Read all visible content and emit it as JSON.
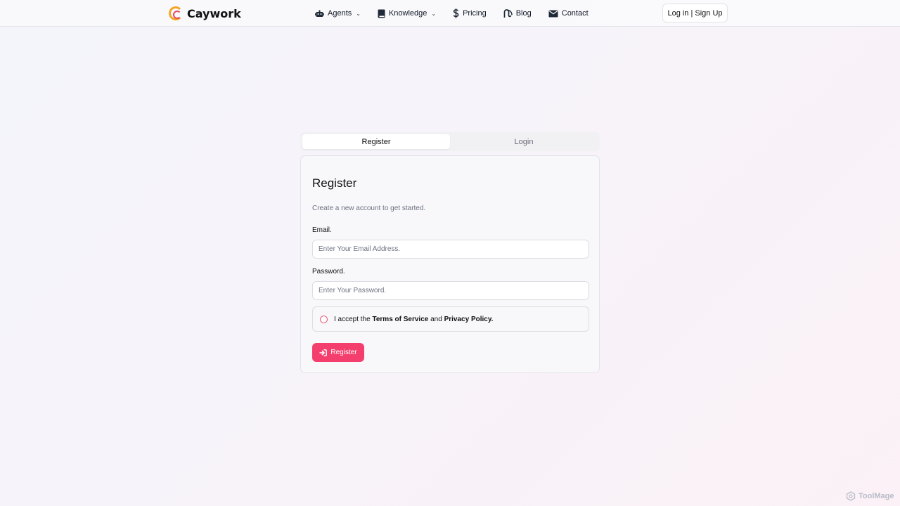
{
  "header": {
    "brand": "Caywork",
    "nav": [
      {
        "label": "Agents",
        "icon": "robot-icon",
        "dropdown": true
      },
      {
        "label": "Knowledge",
        "icon": "book-icon",
        "dropdown": true
      },
      {
        "label": "Pricing",
        "icon": "dollar-icon",
        "dropdown": false
      },
      {
        "label": "Blog",
        "icon": "blog-icon",
        "dropdown": false
      },
      {
        "label": "Contact",
        "icon": "envelope-icon",
        "dropdown": false
      }
    ],
    "auth_label": "Log in | Sign Up"
  },
  "tabs": [
    {
      "label": "Register",
      "active": true
    },
    {
      "label": "Login",
      "active": false
    }
  ],
  "form": {
    "title": "Register",
    "subtitle": "Create a new account to get started.",
    "email_label": "Email.",
    "email_placeholder": "Enter Your Email Address.",
    "password_label": "Password.",
    "password_placeholder": "Enter Your Password.",
    "terms_prefix": "I accept the",
    "terms_link": "Terms of Service",
    "terms_and": "and",
    "privacy_link": "Privacy Policy.",
    "submit_label": "Register"
  },
  "watermark": "ToolMage",
  "colors": {
    "accent": "#f43f6e",
    "logo_orange": "#f5a524",
    "logo_red": "#e8475f"
  }
}
